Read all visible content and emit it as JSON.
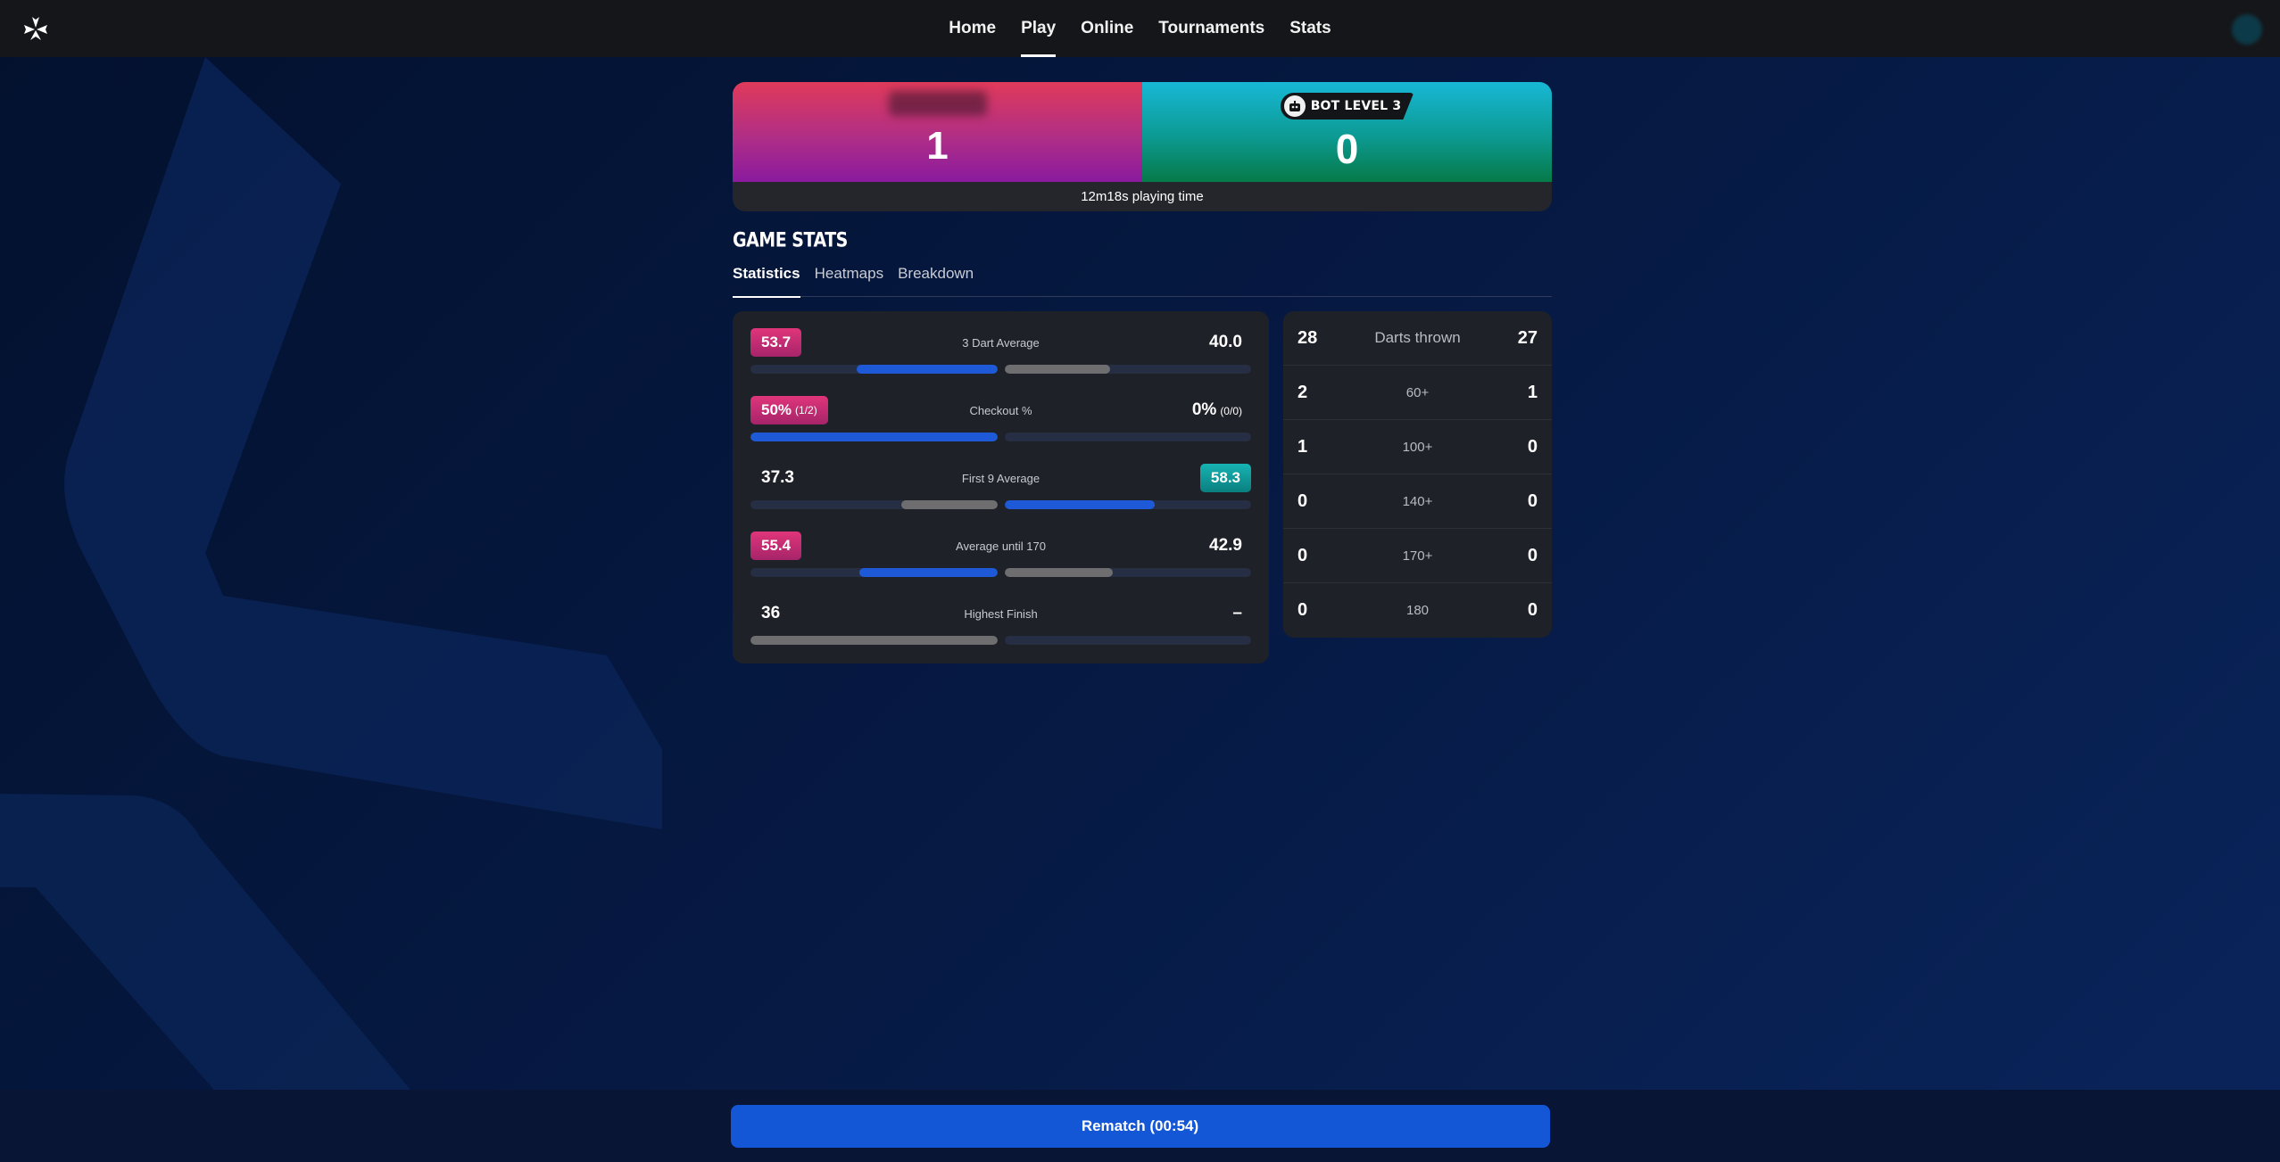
{
  "nav": {
    "items": [
      {
        "label": "Home",
        "active": false
      },
      {
        "label": "Play",
        "active": true
      },
      {
        "label": "Online",
        "active": false
      },
      {
        "label": "Tournaments",
        "active": false
      },
      {
        "label": "Stats",
        "active": false
      }
    ]
  },
  "scoreboard": {
    "player1": {
      "name": "",
      "score": "1"
    },
    "player2": {
      "name": "BOT LEVEL 3",
      "score": "0",
      "icon": "bot-icon"
    },
    "playing_time": "12m18s playing time"
  },
  "section_title": "GAME STATS",
  "tabs": [
    {
      "label": "Statistics",
      "active": true
    },
    {
      "label": "Heatmaps",
      "active": false
    },
    {
      "label": "Breakdown",
      "active": false
    }
  ],
  "stats": [
    {
      "label": "3 Dart Average",
      "left": "53.7",
      "left_sub": "",
      "right": "40.0",
      "right_sub": "",
      "highlight": "left",
      "left_fill": 0.57,
      "right_fill": 0.43,
      "left_color": "blue",
      "right_color": "gray"
    },
    {
      "label": "Checkout %",
      "left": "50%",
      "left_sub": "(1/2)",
      "right": "0%",
      "right_sub": "(0/0)",
      "highlight": "left",
      "left_fill": 1.0,
      "right_fill": 0.0,
      "left_color": "blue",
      "right_color": "gray"
    },
    {
      "label": "First 9 Average",
      "left": "37.3",
      "left_sub": "",
      "right": "58.3",
      "right_sub": "",
      "highlight": "right",
      "left_fill": 0.39,
      "right_fill": 0.61,
      "left_color": "gray",
      "right_color": "blue"
    },
    {
      "label": "Average until 170",
      "left": "55.4",
      "left_sub": "",
      "right": "42.9",
      "right_sub": "",
      "highlight": "left",
      "left_fill": 0.56,
      "right_fill": 0.44,
      "left_color": "blue",
      "right_color": "gray"
    },
    {
      "label": "Highest Finish",
      "left": "36",
      "left_sub": "",
      "right": "–",
      "right_sub": "",
      "highlight": "none",
      "left_fill": 1.0,
      "right_fill": 0.0,
      "left_color": "gray",
      "right_color": "gray"
    }
  ],
  "counts": [
    {
      "label": "Darts thrown",
      "left": "28",
      "right": "27"
    },
    {
      "label": "60+",
      "left": "2",
      "right": "1"
    },
    {
      "label": "100+",
      "left": "1",
      "right": "0"
    },
    {
      "label": "140+",
      "left": "0",
      "right": "0"
    },
    {
      "label": "170+",
      "left": "0",
      "right": "0"
    },
    {
      "label": "180",
      "left": "0",
      "right": "0"
    }
  ],
  "rematch_label": "Rematch (00:54)",
  "colors": {
    "accent": "#1356d6",
    "pink": "#c72c72",
    "teal": "#11a0a0",
    "panel": "#1f2128"
  }
}
